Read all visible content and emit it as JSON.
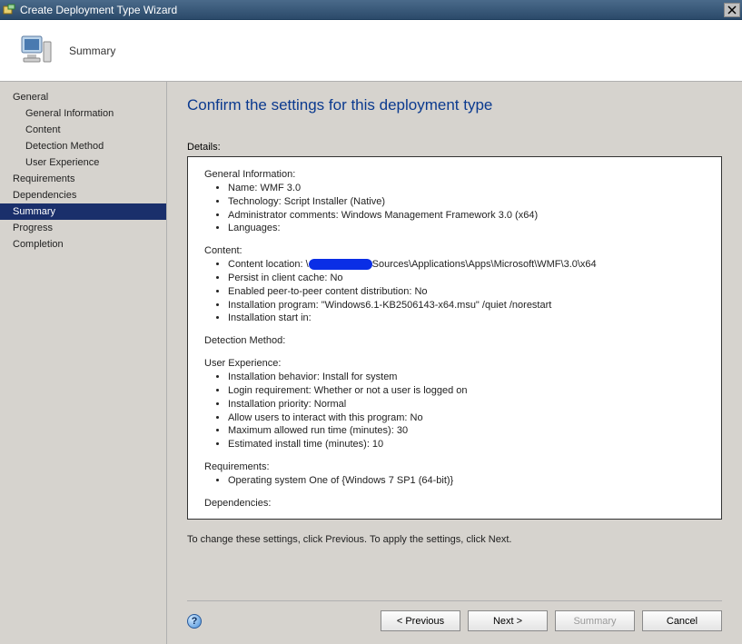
{
  "window": {
    "title": "Create Deployment Type Wizard"
  },
  "header": {
    "step_label": "Summary"
  },
  "sidebar": {
    "items": [
      {
        "label": "General",
        "sub": false
      },
      {
        "label": "General Information",
        "sub": true
      },
      {
        "label": "Content",
        "sub": true
      },
      {
        "label": "Detection Method",
        "sub": true
      },
      {
        "label": "User Experience",
        "sub": true
      },
      {
        "label": "Requirements",
        "sub": false
      },
      {
        "label": "Dependencies",
        "sub": false
      },
      {
        "label": "Summary",
        "sub": false,
        "selected": true
      },
      {
        "label": "Progress",
        "sub": false
      },
      {
        "label": "Completion",
        "sub": false
      }
    ]
  },
  "main": {
    "heading": "Confirm the settings for this deployment type",
    "details_label": "Details:",
    "hint": "To change these settings, click Previous. To apply the settings, click Next.",
    "general_info": {
      "title": "General Information:",
      "name": "Name: WMF 3.0",
      "technology": "Technology: Script Installer (Native)",
      "admin_comments": "Administrator comments:  Windows Management Framework 3.0 (x64)",
      "languages": "Languages:"
    },
    "content": {
      "title": "Content:",
      "location_prefix": "Content location: \\",
      "location_suffix": "Sources\\Applications\\Apps\\Microsoft\\WMF\\3.0\\x64",
      "persist": "Persist in client cache: No",
      "p2p": "Enabled peer-to-peer content distribution: No",
      "install_prog": "Installation program: \"Windows6.1-KB2506143-x64.msu\" /quiet /norestart",
      "start_in": "Installation start in:"
    },
    "detection": {
      "title": "Detection Method:"
    },
    "user_exp": {
      "title": "User Experience:",
      "behavior": "Installation behavior: Install for system",
      "login": "Login requirement: Whether or not a user is logged on",
      "priority": "Installation priority: Normal",
      "interact": "Allow users to interact with this program: No",
      "max_run": "Maximum allowed run time (minutes): 30",
      "est_install": "Estimated install time (minutes): 10"
    },
    "requirements": {
      "title": "Requirements:",
      "os": "Operating system  One of {Windows 7 SP1 (64-bit)}"
    },
    "dependencies": {
      "title": "Dependencies:"
    }
  },
  "footer": {
    "previous": "< Previous",
    "next": "Next >",
    "summary": "Summary",
    "cancel": "Cancel"
  }
}
